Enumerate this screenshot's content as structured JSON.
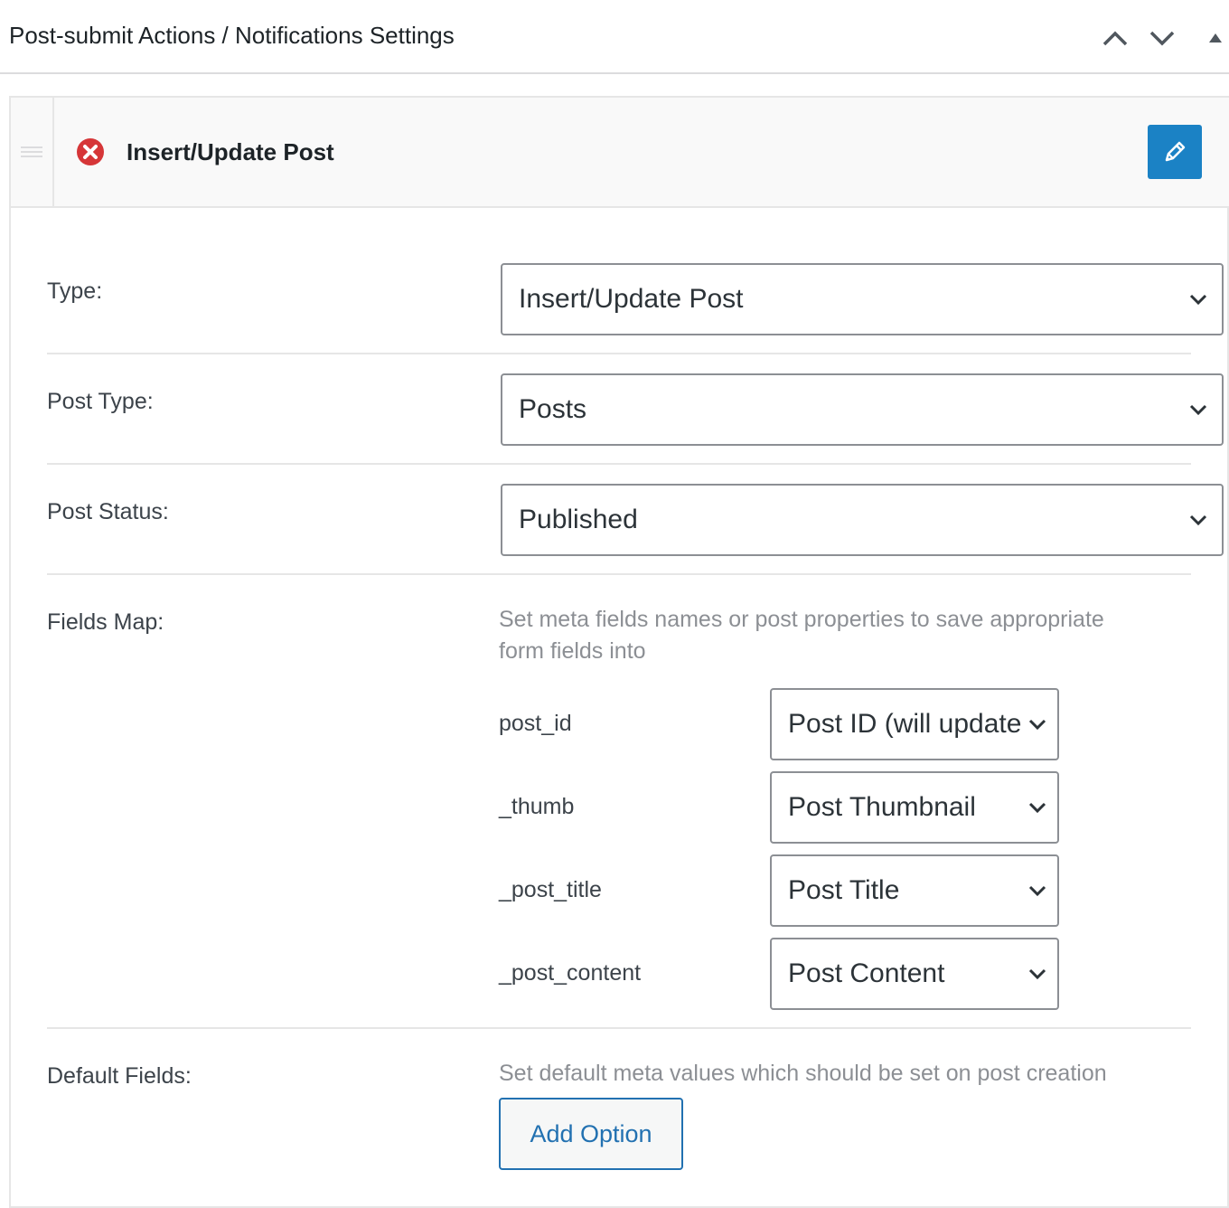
{
  "panel": {
    "title": "Post-submit Actions / Notifications Settings",
    "icons": {
      "move_up": "chevron-up-icon",
      "move_down": "chevron-down-icon",
      "toggle": "triangle-up-icon"
    }
  },
  "action": {
    "title": "Insert/Update Post",
    "icons": {
      "drag": "drag-handle-icon",
      "remove": "remove-circle-icon",
      "edit": "pencil-icon"
    },
    "colors": {
      "edit_button": "#1b82c5",
      "remove": "#d63638"
    }
  },
  "form": {
    "type": {
      "label": "Type:",
      "value": "Insert/Update Post"
    },
    "post_type": {
      "label": "Post Type:",
      "value": "Posts"
    },
    "post_status": {
      "label": "Post Status:",
      "value": "Published"
    },
    "fields_map": {
      "label": "Fields Map:",
      "description": "Set meta fields names or post properties to save appropriate form fields into",
      "rows": [
        {
          "key": "post_id",
          "value": "Post ID (will update"
        },
        {
          "key": "_thumb",
          "value": "Post Thumbnail"
        },
        {
          "key": "_post_title",
          "value": "Post Title"
        },
        {
          "key": "_post_content",
          "value": "Post Content"
        }
      ]
    },
    "default_fields": {
      "label": "Default Fields:",
      "description": "Set default meta values which should be set on post creation",
      "add_button": "Add Option"
    }
  }
}
